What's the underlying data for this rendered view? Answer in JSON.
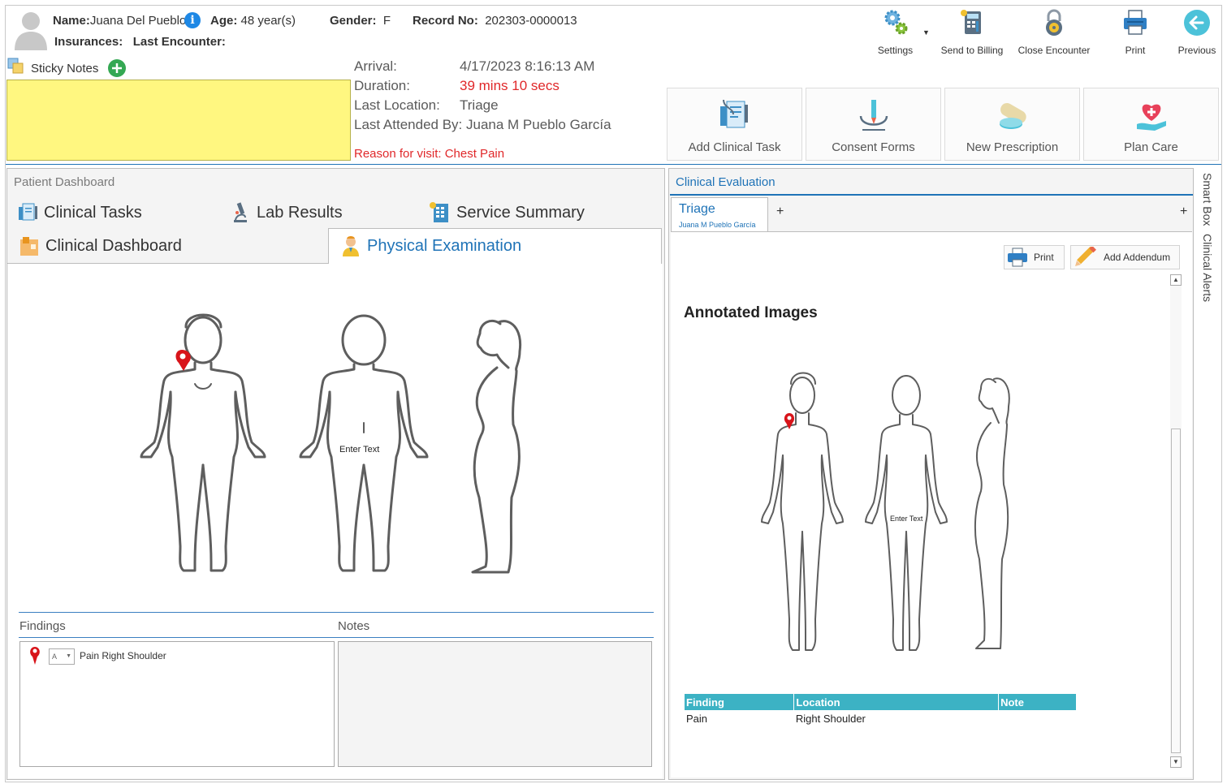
{
  "patient": {
    "name_label": "Name:",
    "name": "Juana Del Pueblo",
    "age_label": "Age:",
    "age": "48 year(s)",
    "gender_label": "Gender:",
    "gender": "F",
    "record_label": "Record No:",
    "record": "202303-0000013",
    "insurances_label": "Insurances:",
    "last_encounter_label": "Last Encounter:"
  },
  "toolbar": {
    "settings": "Settings",
    "send_billing": "Send to Billing",
    "close_encounter": "Close Encounter",
    "print": "Print",
    "previous": "Previous"
  },
  "sticky": {
    "title": "Sticky Notes"
  },
  "encounter": {
    "arrival_label": "Arrival:",
    "arrival": "4/17/2023 8:16:13 AM",
    "duration_label": "Duration:",
    "duration": "39 mins 10 secs",
    "location_label": "Last Location:",
    "location": "Triage",
    "attended": "Last Attended By: Juana M Pueblo García",
    "reason": "Reason for visit: Chest Pain"
  },
  "actions": {
    "add_clinical_task": "Add Clinical Task",
    "consent_forms": "Consent Forms",
    "new_prescription": "New Prescription",
    "plan_care": "Plan Care"
  },
  "dashboard": {
    "title": "Patient Dashboard",
    "tabs": {
      "clinical_tasks": "Clinical Tasks",
      "lab_results": "Lab Results",
      "service_summary": "Service Summary",
      "clinical_dashboard": "Clinical Dashboard",
      "physical_examination": "Physical Examination"
    },
    "body_text": "Enter Text",
    "findings_header": "Findings",
    "notes_header": "Notes",
    "finding_item": "Pain Right Shoulder"
  },
  "evaluation": {
    "title": "Clinical Evaluation",
    "tab_name": "Triage",
    "tab_sub": "Juana M Pueblo García",
    "add_tab": "+",
    "print": "Print",
    "add_addendum": "Add Addendum",
    "annotated_title": "Annotated Images",
    "body_text": "Enter Text",
    "table": {
      "headers": [
        "Finding",
        "Location",
        "Note"
      ],
      "rows": [
        [
          "Pain",
          "Right Shoulder",
          ""
        ]
      ]
    }
  },
  "side": {
    "smart_box": "Smart Box",
    "clinical_alerts": "Clinical Alerts"
  },
  "colors": {
    "accent": "#1f73b7",
    "alert": "#e0282a",
    "sticky": "#fff780",
    "table_header": "#3cb2c4"
  }
}
